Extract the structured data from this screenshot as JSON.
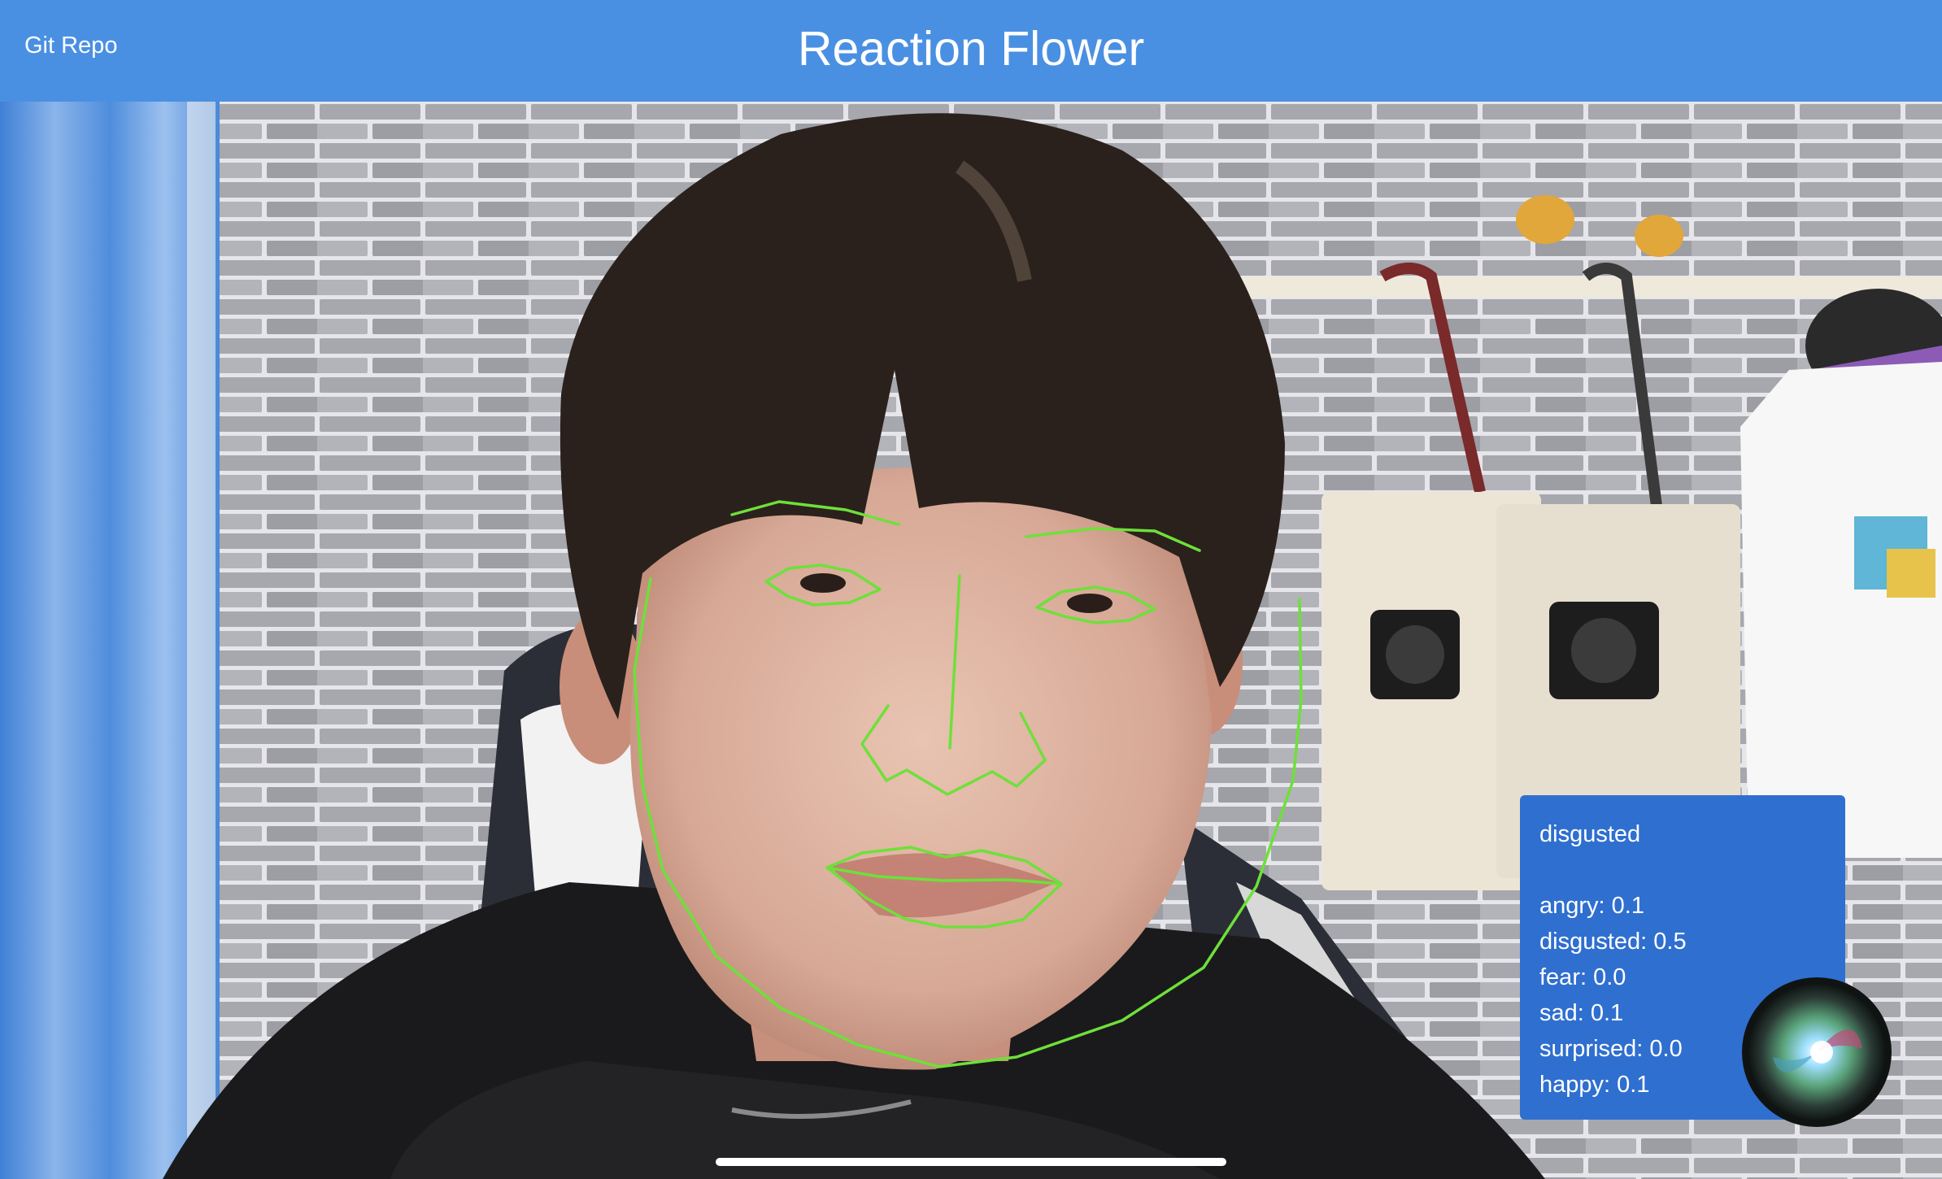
{
  "navbar": {
    "link_label": "Git Repo",
    "title": "Reaction Flower"
  },
  "emotion_panel": {
    "dominant_emotion": "disgusted",
    "scores": [
      {
        "text": "angry: 0.1"
      },
      {
        "text": "disgusted: 0.5"
      },
      {
        "text": "fear: 0.0"
      },
      {
        "text": "sad: 0.1"
      },
      {
        "text": "surprised: 0.0"
      },
      {
        "text": "happy: 0.1"
      }
    ]
  },
  "colors": {
    "navbar": "#4a90e2",
    "panel": "#2f6fd0",
    "landmarks": "#6ee03a"
  },
  "icons": {
    "assistant": "siri-orb-icon"
  }
}
